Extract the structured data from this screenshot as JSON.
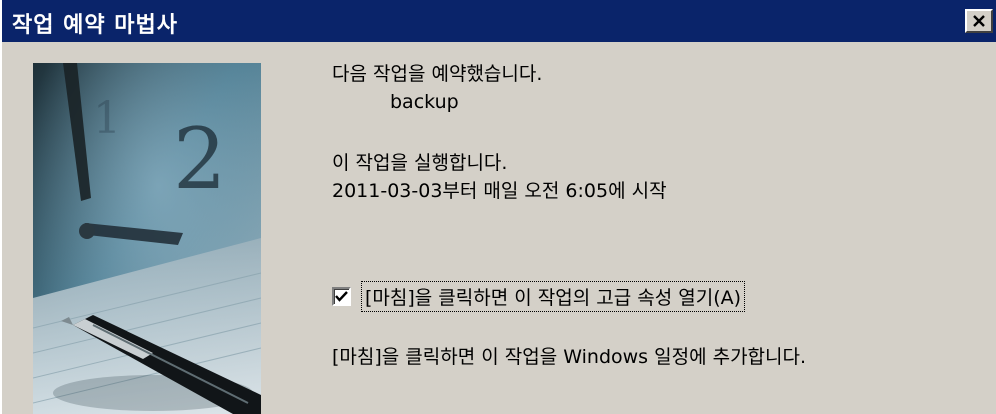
{
  "window": {
    "title": "작업 예약 마법사",
    "close_symbol": "×"
  },
  "summary": {
    "scheduled_heading": "다음 작업을 예약했습니다.",
    "task_name": "backup",
    "run_heading": "이 작업을 실행합니다.",
    "schedule_detail": "2011-03-03부터 매일 오전 6:05에 시작"
  },
  "options": {
    "open_advanced": {
      "label": "[마침]을 클릭하면 이 작업의 고급 속성 열기(A)",
      "checked": true
    },
    "info": "[마침]을 클릭하면 이 작업을 Windows 일정에 추가합니다."
  },
  "icons": {
    "close": "close-icon",
    "checkmark": "checkmark-icon",
    "wizard_image": "clock-pen-illustration"
  },
  "colors": {
    "titlebar": "#0a246a",
    "dialog_bg": "#d4d0c8"
  }
}
